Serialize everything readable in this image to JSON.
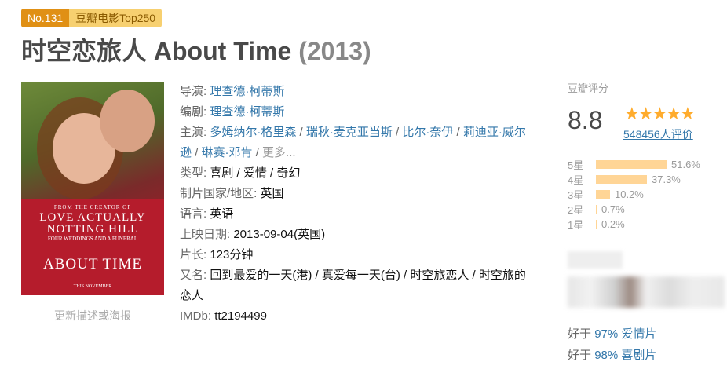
{
  "badge": {
    "number": "No.131",
    "list": "豆瓣电影Top250"
  },
  "title": {
    "name": "时空恋旅人 About Time",
    "year": "(2013)"
  },
  "poster": {
    "line1": "FROM THE CREATOR OF",
    "line2a": "LOVE ACTUALLY",
    "line2b": "NOTTING HILL",
    "line3": "FOUR WEDDINGS AND A FUNERAL",
    "line4": "ABOUT TIME",
    "line5": "THIS NOVEMBER",
    "update_link": "更新描述或海报"
  },
  "info": {
    "director_label": "导演:",
    "director": "理查德·柯蒂斯",
    "writer_label": "编剧:",
    "writer": "理查德·柯蒂斯",
    "cast_label": "主演:",
    "cast": [
      "多姆纳尔·格里森",
      "瑞秋·麦克亚当斯",
      "比尔·奈伊",
      "莉迪亚·威尔逊",
      "琳赛·邓肯"
    ],
    "cast_more": "更多...",
    "genre_label": "类型:",
    "genre": "喜剧 / 爱情 / 奇幻",
    "country_label": "制片国家/地区:",
    "country": "英国",
    "language_label": "语言:",
    "language": "英语",
    "release_label": "上映日期:",
    "release": "2013-09-04(英国)",
    "runtime_label": "片长:",
    "runtime": "123分钟",
    "aka_label": "又名:",
    "aka": "回到最爱的一天(港) / 真爱每一天(台) / 时空旅恋人 / 时空旅的恋人",
    "imdb_label": "IMDb:",
    "imdb": "tt2194499"
  },
  "rating": {
    "label": "豆瓣评分",
    "score": "8.8",
    "count": "548456人评价",
    "stars_value": 4.5,
    "star_color": "#ffac2d",
    "bar_color": "#ffd596",
    "distribution": [
      {
        "label": "5星",
        "value": "51.6%",
        "pct": 51.6
      },
      {
        "label": "4星",
        "value": "37.3%",
        "pct": 37.3
      },
      {
        "label": "3星",
        "value": "10.2%",
        "pct": 10.2
      },
      {
        "label": "2星",
        "value": "0.7%",
        "pct": 0.7
      },
      {
        "label": "1星",
        "value": "0.2%",
        "pct": 0.2
      }
    ]
  },
  "better_than": [
    {
      "prefix": "好于",
      "pct": "97%",
      "genre": "爱情片"
    },
    {
      "prefix": "好于",
      "pct": "98%",
      "genre": "喜剧片"
    }
  ]
}
